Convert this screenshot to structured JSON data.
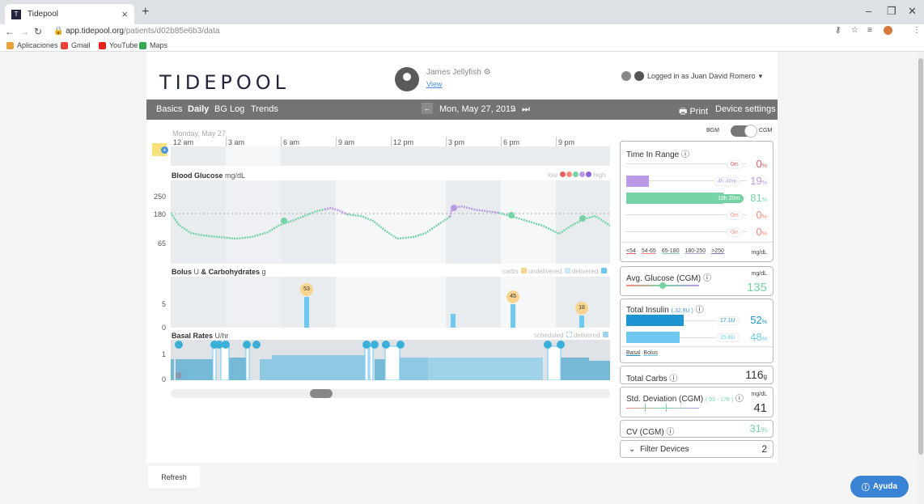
{
  "browser": {
    "tab_title": "Tidepool",
    "url_host": "app.tidepool.org",
    "url_path": "/patients/d02b85e6b3/data",
    "bookmarks": [
      "Aplicaciones",
      "Gmail",
      "YouTube",
      "Maps"
    ]
  },
  "header": {
    "logo": "TIDEPOOL",
    "patient_name": "James Jellyfish",
    "view_link": "View",
    "logged_in": "Logged in as Juan David Romero"
  },
  "navbar": {
    "tabs": [
      "Basics",
      "Daily",
      "BG Log",
      "Trends"
    ],
    "active_tab": "Daily",
    "date": "Mon, May 27, 2019",
    "print": "Print",
    "device_settings": "Device settings"
  },
  "chart": {
    "day_label": "Monday, May 27",
    "hours": [
      "12 am",
      "3 am",
      "6 am",
      "9 am",
      "12 pm",
      "3 pm",
      "6 pm",
      "9 pm"
    ],
    "bg_title": "Blood Glucose",
    "bg_unit": "mg/dL",
    "bg_ticks": [
      "250",
      "180",
      "65"
    ],
    "bg_legend_low": "low",
    "bg_legend_high": "high",
    "bolus_title": "Bolus",
    "bolus_unit_u": "U",
    "bolus_amp": "&",
    "bolus_carbs": "Carbohydrates",
    "bolus_unit_g": "g",
    "bolus_ticks": [
      "5",
      "0"
    ],
    "bolus_legend": [
      "carbs",
      "undelivered",
      "delivered"
    ],
    "carbs": [
      "53",
      "45",
      "18"
    ],
    "basal_title": "Basal Rates",
    "basal_unit": "U/hr",
    "basal_ticks": [
      "1",
      "0"
    ],
    "basal_legend": [
      "scheduled",
      "delivered"
    ],
    "bgm_label": "BGM",
    "cgm_label": "CGM"
  },
  "stats": {
    "tir": {
      "title": "Time In Range",
      "rows": [
        {
          "time": "0m",
          "pct": "0",
          "color": "#e35f5f",
          "fill": 0
        },
        {
          "time": "4h 40m",
          "pct": "19",
          "color": "#bb9ae7",
          "fill": 0.19
        },
        {
          "time": "19h 20m",
          "pct": "81",
          "color": "#76d3a6",
          "fill": 0.81
        },
        {
          "time": "0m",
          "pct": "0",
          "color": "#ff8b7c",
          "fill": 0
        },
        {
          "time": "0m",
          "pct": "0",
          "color": "#ff8b7c",
          "fill": 0
        }
      ],
      "ranges": [
        "<54",
        "54-65",
        "65-180",
        "180-250",
        ">250"
      ],
      "unit": "mg/dL",
      "pct_sign": "%"
    },
    "avg_glucose": {
      "title": "Avg. Glucose (CGM)",
      "unit": "mg/dL",
      "value": "135"
    },
    "total_insulin": {
      "title": "Total Insulin",
      "total": "( 32.9U )",
      "basal_val": "17.1U",
      "basal_pct": "52",
      "bolus_val": "15.8U",
      "bolus_pct": "48",
      "tabs": [
        "Basal",
        "Bolus"
      ]
    },
    "total_carbs": {
      "title": "Total Carbs",
      "value": "116",
      "unit": "g"
    },
    "std_dev": {
      "title": "Std. Deviation (CGM)",
      "range": "( 93 - 176 )",
      "unit": "mg/dL",
      "value": "41"
    },
    "cv": {
      "title": "CV (CGM)",
      "value": "31"
    },
    "filter": {
      "title": "Filter Devices",
      "count": "2"
    }
  },
  "buttons": {
    "refresh": "Refresh",
    "help": "Ayuda"
  },
  "colors": {
    "target": "#76d3a6",
    "high": "#bb9ae7",
    "bolus": "#6ec8f0",
    "basal": "#9fd3ea",
    "navbar": "#737373"
  }
}
